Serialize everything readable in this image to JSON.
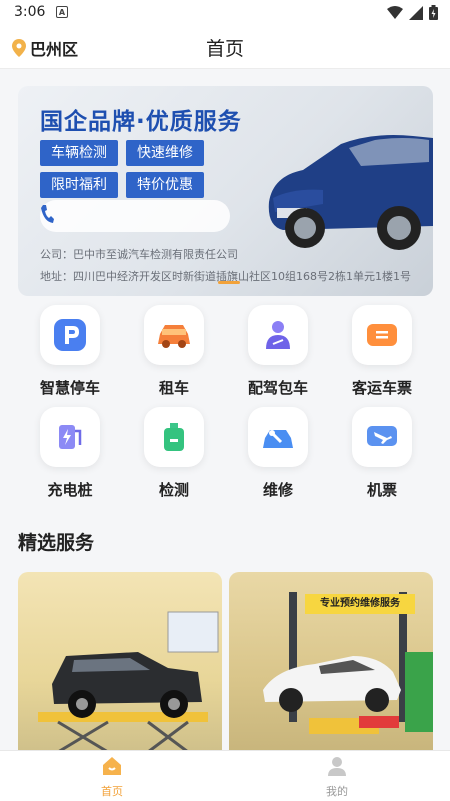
{
  "status_bar": {
    "time": "3:06",
    "notification_glyph": "A"
  },
  "header": {
    "location": "巴州区",
    "title": "首页"
  },
  "banner": {
    "headline": "国企品牌·优质服务",
    "tags": [
      "车辆检测",
      "快速维修",
      "限时福利",
      "特价优惠"
    ],
    "company": "公司：巴中市至诚汽车检测有限责任公司",
    "address": "地址：四川巴中经济开发区时新街道插旗山社区10组168号2栋1单元1楼1号"
  },
  "services": [
    {
      "label": "智慧停车",
      "icon": "parking-icon"
    },
    {
      "label": "租车",
      "icon": "car-rental-icon"
    },
    {
      "label": "配驾包车",
      "icon": "driver-icon"
    },
    {
      "label": "客运车票",
      "icon": "ticket-icon"
    },
    {
      "label": "充电桩",
      "icon": "charging-icon"
    },
    {
      "label": "检测",
      "icon": "inspection-icon"
    },
    {
      "label": "维修",
      "icon": "repair-icon"
    },
    {
      "label": "机票",
      "icon": "flight-icon"
    }
  ],
  "section": {
    "title": "精选服务"
  },
  "cards": {
    "card2_sign": "专业预约维修服务"
  },
  "tabbar": {
    "home_label": "首页",
    "mine_label": "我的"
  },
  "colors": {
    "accent": "#f2a23a",
    "brand_blue": "#2f64c8",
    "tab_inactive": "#999999"
  }
}
